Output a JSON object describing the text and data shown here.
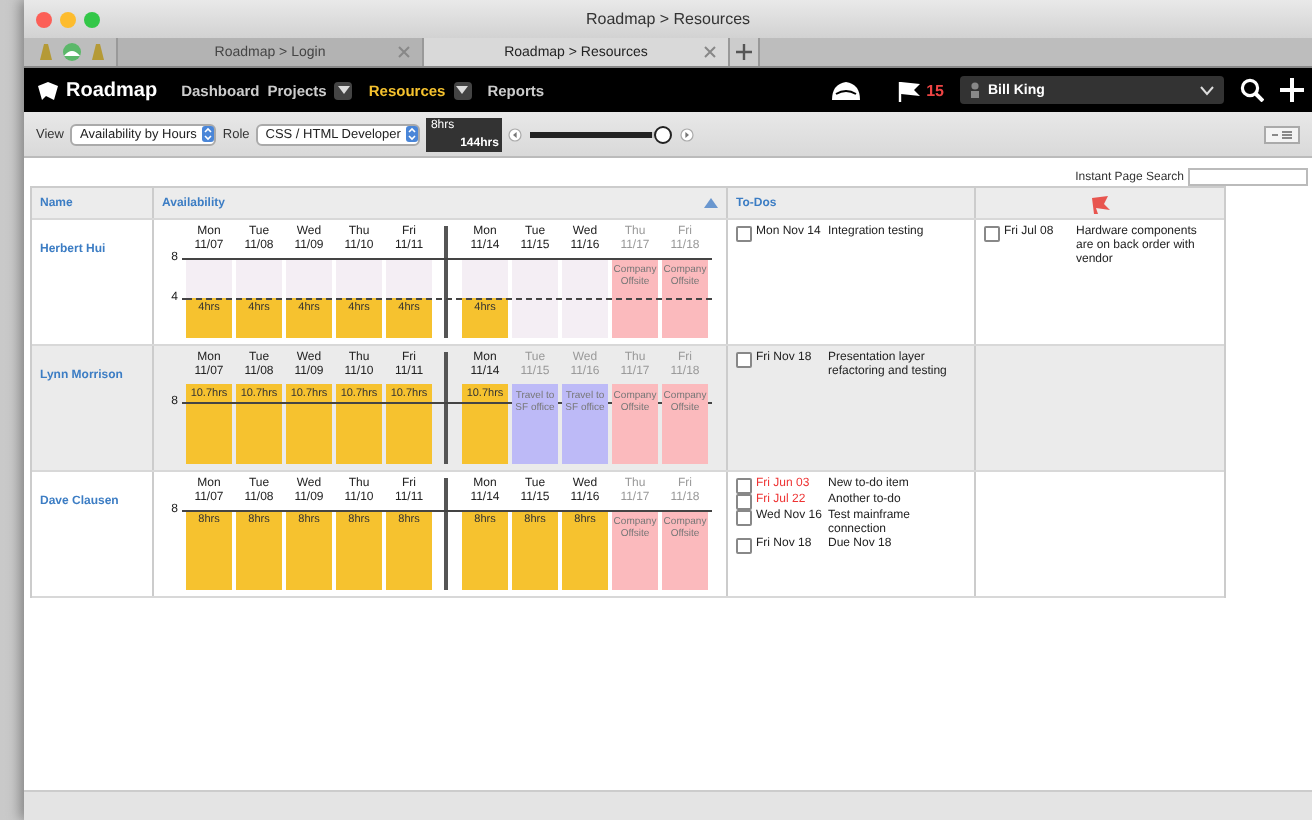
{
  "window": {
    "title": "Roadmap > Resources"
  },
  "browser_tabs": [
    {
      "label": "Roadmap > Login",
      "selected": false
    },
    {
      "label": "Roadmap > Resources",
      "selected": true
    }
  ],
  "nav": {
    "logo": "Roadmap",
    "items": [
      {
        "label": "Dashboard",
        "selected": false,
        "dropdown": false
      },
      {
        "label": "Projects",
        "selected": false,
        "dropdown": true
      },
      {
        "label": "Resources",
        "selected": true,
        "dropdown": true
      },
      {
        "label": "Reports",
        "selected": false,
        "dropdown": false
      }
    ],
    "flag_count": "15",
    "user": "Bill King"
  },
  "toolbar": {
    "view_label": "View",
    "view": "Availability by Hours",
    "role_label": "Role",
    "role": "CSS / HTML Developer",
    "range_min": "8hrs",
    "range_max": "144hrs",
    "slider": {
      "level": 0.97
    }
  },
  "search": {
    "label": "Instant Page Search"
  },
  "table": {
    "columns": [
      "Name",
      "Availability",
      "To-Dos"
    ],
    "rows": [
      {
        "name": "Herbert Hui",
        "axis": [
          {
            "label": "8",
            "level": 1,
            "dashed": false
          },
          {
            "label": "4",
            "level": 0.5,
            "dashed": true
          }
        ],
        "weeks": [
          {
            "days": [
              {
                "day": "Mon",
                "date": "11/07",
                "dimmed": false,
                "kind": "hours",
                "level": 0.5,
                "text": "4hrs"
              },
              {
                "day": "Tue",
                "date": "11/08",
                "dimmed": false,
                "kind": "hours",
                "level": 0.5,
                "text": "4hrs"
              },
              {
                "day": "Wed",
                "date": "11/09",
                "dimmed": false,
                "kind": "hours",
                "level": 0.5,
                "text": "4hrs"
              },
              {
                "day": "Thu",
                "date": "11/10",
                "dimmed": false,
                "kind": "hours",
                "level": 0.5,
                "text": "4hrs"
              },
              {
                "day": "Fri",
                "date": "11/11",
                "dimmed": false,
                "kind": "hours",
                "level": 0.5,
                "text": "4hrs"
              }
            ]
          },
          {
            "days": [
              {
                "day": "Mon",
                "date": "11/14",
                "dimmed": false,
                "kind": "hours",
                "level": 0.5,
                "text": "4hrs"
              },
              {
                "day": "Tue",
                "date": "11/15",
                "dimmed": false,
                "kind": "free"
              },
              {
                "day": "Wed",
                "date": "11/16",
                "dimmed": false,
                "kind": "free"
              },
              {
                "day": "Thu",
                "date": "11/17",
                "dimmed": true,
                "kind": "offsite",
                "text": "Company Offsite"
              },
              {
                "day": "Fri",
                "date": "11/18",
                "dimmed": true,
                "kind": "offsite",
                "text": "Company Offsite"
              }
            ]
          }
        ],
        "todos": [
          {
            "date": "Mon Nov 14",
            "text": "Integration testing",
            "overdue": false,
            "checked": false
          }
        ],
        "flags": [
          {
            "date": "Fri Jul 08",
            "text": "Hardware components are on back order with vendor",
            "overdue": false,
            "checked": false
          }
        ]
      },
      {
        "name": "Lynn Morrison",
        "axis": [
          {
            "label": "8",
            "level": 0.77,
            "dashed": false
          }
        ],
        "weeks": [
          {
            "days": [
              {
                "day": "Mon",
                "date": "11/07",
                "dimmed": false,
                "kind": "hours",
                "level": 1,
                "text": "10.7hrs"
              },
              {
                "day": "Tue",
                "date": "11/08",
                "dimmed": false,
                "kind": "hours",
                "level": 1,
                "text": "10.7hrs"
              },
              {
                "day": "Wed",
                "date": "11/09",
                "dimmed": false,
                "kind": "hours",
                "level": 1,
                "text": "10.7hrs"
              },
              {
                "day": "Thu",
                "date": "11/10",
                "dimmed": false,
                "kind": "hours",
                "level": 1,
                "text": "10.7hrs"
              },
              {
                "day": "Fri",
                "date": "11/11",
                "dimmed": false,
                "kind": "hours",
                "level": 1,
                "text": "10.7hrs"
              }
            ]
          },
          {
            "days": [
              {
                "day": "Mon",
                "date": "11/14",
                "dimmed": false,
                "kind": "hours",
                "level": 1,
                "text": "10.7hrs"
              },
              {
                "day": "Tue",
                "date": "11/15",
                "dimmed": true,
                "kind": "travel",
                "text": "Travel to SF office"
              },
              {
                "day": "Wed",
                "date": "11/16",
                "dimmed": true,
                "kind": "travel",
                "text": "Travel to SF office"
              },
              {
                "day": "Thu",
                "date": "11/17",
                "dimmed": true,
                "kind": "offsite",
                "text": "Company Offsite"
              },
              {
                "day": "Fri",
                "date": "11/18",
                "dimmed": true,
                "kind": "offsite",
                "text": "Company Offsite"
              }
            ]
          }
        ],
        "todos": [
          {
            "date": "Fri Nov 18",
            "text": "Presentation layer refactoring and testing",
            "overdue": false,
            "checked": false
          }
        ],
        "flags": []
      },
      {
        "name": "Dave Clausen",
        "axis": [
          {
            "label": "8",
            "level": 1,
            "dashed": false
          }
        ],
        "weeks": [
          {
            "days": [
              {
                "day": "Mon",
                "date": "11/07",
                "dimmed": false,
                "kind": "hours",
                "level": 1,
                "text": "8hrs"
              },
              {
                "day": "Tue",
                "date": "11/08",
                "dimmed": false,
                "kind": "hours",
                "level": 1,
                "text": "8hrs"
              },
              {
                "day": "Wed",
                "date": "11/09",
                "dimmed": false,
                "kind": "hours",
                "level": 1,
                "text": "8hrs"
              },
              {
                "day": "Thu",
                "date": "11/10",
                "dimmed": false,
                "kind": "hours",
                "level": 1,
                "text": "8hrs"
              },
              {
                "day": "Fri",
                "date": "11/11",
                "dimmed": false,
                "kind": "hours",
                "level": 1,
                "text": "8hrs"
              }
            ]
          },
          {
            "days": [
              {
                "day": "Mon",
                "date": "11/14",
                "dimmed": false,
                "kind": "hours",
                "level": 1,
                "text": "8hrs"
              },
              {
                "day": "Tue",
                "date": "11/15",
                "dimmed": false,
                "kind": "hours",
                "level": 1,
                "text": "8hrs"
              },
              {
                "day": "Wed",
                "date": "11/16",
                "dimmed": false,
                "kind": "hours",
                "level": 1,
                "text": "8hrs"
              },
              {
                "day": "Thu",
                "date": "11/17",
                "dimmed": true,
                "kind": "offsite",
                "text": "Company Offsite"
              },
              {
                "day": "Fri",
                "date": "11/18",
                "dimmed": true,
                "kind": "offsite",
                "text": "Company Offsite"
              }
            ]
          }
        ],
        "todos": [
          {
            "date": "Fri Jun 03",
            "text": "New to-do item",
            "overdue": true,
            "checked": false
          },
          {
            "date": "Fri Jul 22",
            "text": "Another to-do",
            "overdue": true,
            "checked": false
          },
          {
            "date": "Wed Nov 16",
            "text": "Test mainframe connection",
            "overdue": false,
            "checked": false
          },
          {
            "date": "Fri Nov 18",
            "text": "Due Nov 18",
            "overdue": false,
            "checked": false
          }
        ],
        "flags": []
      }
    ]
  }
}
